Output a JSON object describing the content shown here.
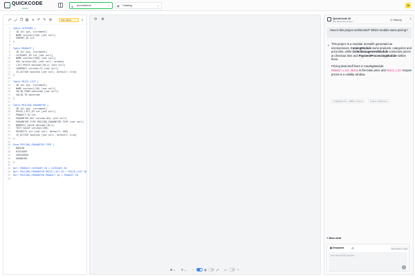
{
  "app": {
    "logo_text": "QUICKCODE",
    "logo_sub": "Studio",
    "user_initials": "JP"
  },
  "header": {
    "project_selector": {
      "icon": "layers-icon",
      "value": "ecommerce"
    },
    "module_selector": {
      "icon": "box-icon",
      "value": "Catalog"
    }
  },
  "editor": {
    "dialect_label": "SQL (draft)",
    "toolbar_icons": [
      "undo-icon",
      "redo-icon",
      "copy-icon",
      "paste-icon",
      "format-icon",
      "back-icon",
      "forward-icon",
      "settings-icon",
      "search-icon"
    ],
    "lines": [
      "Table CATEGORY {",
      "  ID int [pk, increment]",
      "  NAME varchar(128) [not null]",
      "  PARENT_ID int",
      "}",
      "",
      "Table PRODUCT {",
      "  ID int [pk, increment]",
      "  CATEGORY_ID int [not null]",
      "  NAME varchar(200) [not null]",
      "  SKU varchar(64) [not null, unique]",
      "  LIST_PRICE decimal(18,2) [not null]",
      "  CURRENCY varchar(3) [not null]",
      "  IS_ACTIVE boolean [not null, default: true]",
      "}",
      "",
      "Table PRICE_LIST {",
      "  ID int [pk, increment]",
      "  NAME varchar(128) [not null]",
      "  VALID_FROM datetime [not null]",
      "  VALID_TO datetime",
      "}",
      "",
      "Table PRICING_PARAMETER {",
      "  ID int [pk, increment]",
      "  PRICE_LIST_ID int [not null]",
      "  PRODUCT_ID int",
      "  PARAMETER_KEY varchar(64) [not null]",
      "  PARAMETER_TYPE PRICING_PARAMETER_TYPE [not null]",
      "  NUMERIC_VALUE decimal(18,4)",
      "  TEXT_VALUE varchar(256)",
      "  PRIORITY int [not null, default: 100]",
      "  IS_ACTIVE boolean [not null, default: true]",
      "}",
      "",
      "Enum PRICING_PARAMETER_TYPE {",
      "  MARGIN",
      "  DISCOUNT",
      "  SURCHARGE",
      "  ROUNDING",
      "}",
      "",
      "Ref: PRODUCT.CATEGORY_ID > CATEGORY.ID",
      "Ref: PRICING_PARAMETER.PRICE_LIST_ID > PRICE_LIST.ID",
      "Ref: PRICING_PARAMETER.PRODUCT_ID > PRODUCT.ID",
      ""
    ]
  },
  "canvas": {
    "top_icons": [
      "refresh-icon",
      "settings-icon"
    ],
    "bottom": {
      "layout_label": "⊞ ⌄",
      "filter_label": "⚲ ⌄",
      "minus_label": "−",
      "plus_label": "+",
      "toggle_a_on": true,
      "toggle_b_on": false
    }
  },
  "chat": {
    "title": "QuickCode AI",
    "subtitle": "Ask about this project",
    "history_label": "History",
    "user_question": "How is this project architected? Which module owns pricing?",
    "answer_p1_a": "This project is a modular monolith generated as microservices. ",
    "answer_p1_b": "CatalogModule",
    "answer_p1_c": " owns products, categories and price lists, while ",
    "answer_p1_d": "OrderManagementModule",
    "answer_p1_e": " consumes prices at checkout time and ",
    "answer_p1_f": "PaymentProcessingModule",
    "answer_p1_g": " settles them.",
    "answer_p2_a": "Pricing data itself lives in CatalogModule: ",
    "answer_p2_b": "PRODUCT.LIST_PRICE",
    "answer_p2_c": " is the base price and ",
    "answer_p2_d": "PRICE_LIST",
    "answer_p2_e": " scopes prices to a validity window.",
    "chips": [
      "CatalogService / DBML schema",
      "Project architecture"
    ],
    "new_chat_label": "+ New chat",
    "composer": {
      "model_label": "Deepseek",
      "discussion_label": "Discussion mode",
      "placeholder": "Ask about this project..."
    }
  }
}
